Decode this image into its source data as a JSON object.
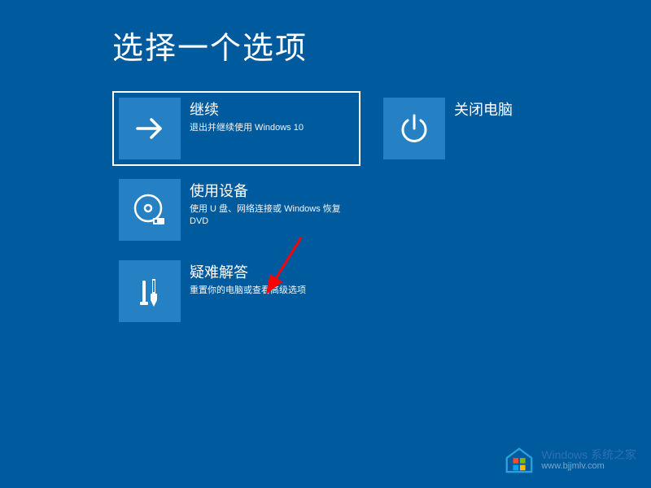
{
  "title": "选择一个选项",
  "options": {
    "continue": {
      "title": "继续",
      "subtitle": "退出并继续使用 Windows 10"
    },
    "shutdown": {
      "title": "关闭电脑"
    },
    "device": {
      "title": "使用设备",
      "subtitle": "使用 U 盘、网络连接或 Windows 恢复 DVD"
    },
    "troubleshoot": {
      "title": "疑难解答",
      "subtitle": "重置你的电脑或查看高级选项"
    }
  },
  "watermark": {
    "title": "Windows 系统之家",
    "url": "www.bjjmlv.com"
  },
  "colors": {
    "background": "#005a9e",
    "tile_icon": "#2680c4",
    "arrow": "#ff0000"
  }
}
